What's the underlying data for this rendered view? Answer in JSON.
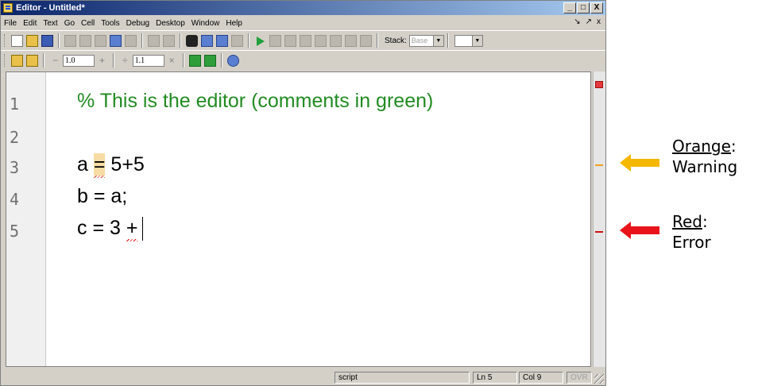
{
  "window": {
    "title": "Editor - Untitled*",
    "controls": {
      "minimize": "_",
      "maximize": "□",
      "close": "X"
    }
  },
  "menu": {
    "items": [
      "File",
      "Edit",
      "Text",
      "Go",
      "Cell",
      "Tools",
      "Debug",
      "Desktop",
      "Window",
      "Help"
    ],
    "dock_controls": [
      "↘",
      "↗",
      "x"
    ]
  },
  "toolbar": {
    "stack_label": "Stack:",
    "stack_value": "Base",
    "icons": [
      "new-file-icon",
      "open-file-icon",
      "save-icon",
      "cut-icon",
      "copy-icon",
      "paste-icon",
      "undo-icon",
      "redo-icon",
      "print-icon",
      "clear-icon",
      "find-icon",
      "back-arrow-icon",
      "forward-arrow-icon",
      "function-icon",
      "run-icon",
      "breakpoint-set-icon",
      "breakpoint-clear-icon",
      "step-icon",
      "step-in-icon",
      "step-out-icon",
      "continue-icon",
      "exit-debug-icon"
    ]
  },
  "cell_toolbar": {
    "minus": "−",
    "increment_value": "1.0",
    "plus": "+",
    "divide": "÷",
    "factor_value": "1.1",
    "times": "×"
  },
  "editor": {
    "lines": [
      {
        "number": "1",
        "kind": "comment",
        "text": "% This is the editor (comments in green)"
      },
      {
        "number": "2",
        "kind": "blank",
        "text": ""
      },
      {
        "number": "3",
        "kind": "warning",
        "before": "a ",
        "highlight": "=",
        "after": " 5+5"
      },
      {
        "number": "4",
        "kind": "code",
        "text": "b = a;"
      },
      {
        "number": "5",
        "kind": "error",
        "before": "c = 3 ",
        "highlight": "+",
        "after": ""
      }
    ]
  },
  "statusbar": {
    "mode": "script",
    "line": "Ln  5",
    "col": "Col  9",
    "ovr": "OVR"
  },
  "annotations": {
    "orange": {
      "label": "Orange",
      "suffix": ":",
      "meaning": "Warning",
      "color": "#f5b800"
    },
    "red": {
      "label": "Red",
      "suffix": ":",
      "meaning": "Error",
      "color": "#e8141a"
    }
  },
  "colors": {
    "comment": "#228b22",
    "warning_mark": "#f0a020",
    "error_mark": "#d01010",
    "title_gradient_start": "#0a246a"
  }
}
